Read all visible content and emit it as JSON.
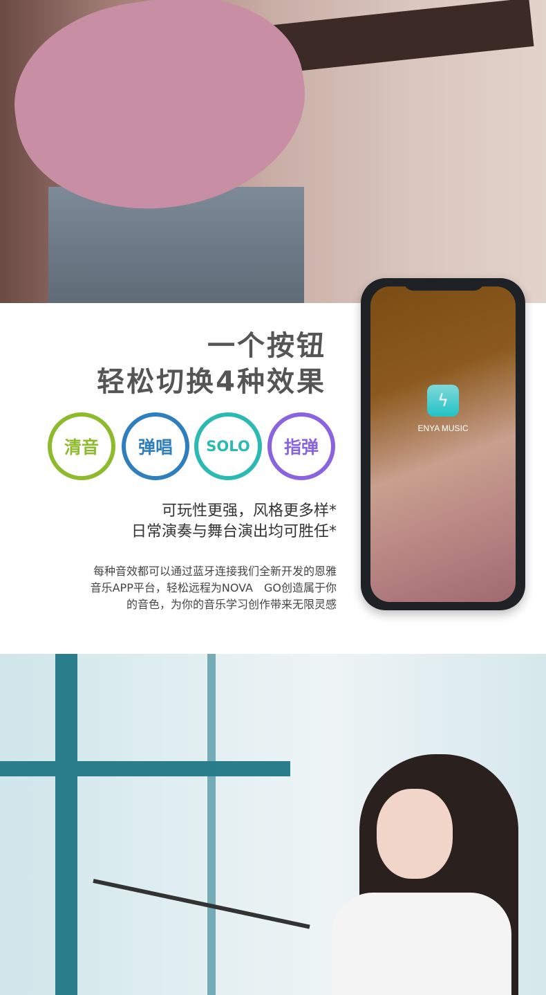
{
  "headline": {
    "line1": "一个按钮",
    "line2": "轻松切换4种效果"
  },
  "modes": [
    {
      "label": "清音",
      "color": "#8dbb2c"
    },
    {
      "label": "弹唱",
      "color": "#2f7fbf"
    },
    {
      "label": "SOLO",
      "color": "#2bb9b3"
    },
    {
      "label": "指弹",
      "color": "#8a63e0"
    }
  ],
  "subtitle": {
    "line1": "可玩性更强，风格更多样*",
    "line2": "日常演奏与舞台演出均可胜任*"
  },
  "description": {
    "line1": "每种音效都可以通过蓝牙连接我们全新开发的恩雅",
    "line2": "音乐APP平台，轻松远程为NOVA　GO创造属于你",
    "line3": "的音色，为你的音乐学习创作带来无限灵感"
  },
  "phone": {
    "app_name": "ENYA MUSIC",
    "app_icon": "enya-music-logo-icon"
  }
}
